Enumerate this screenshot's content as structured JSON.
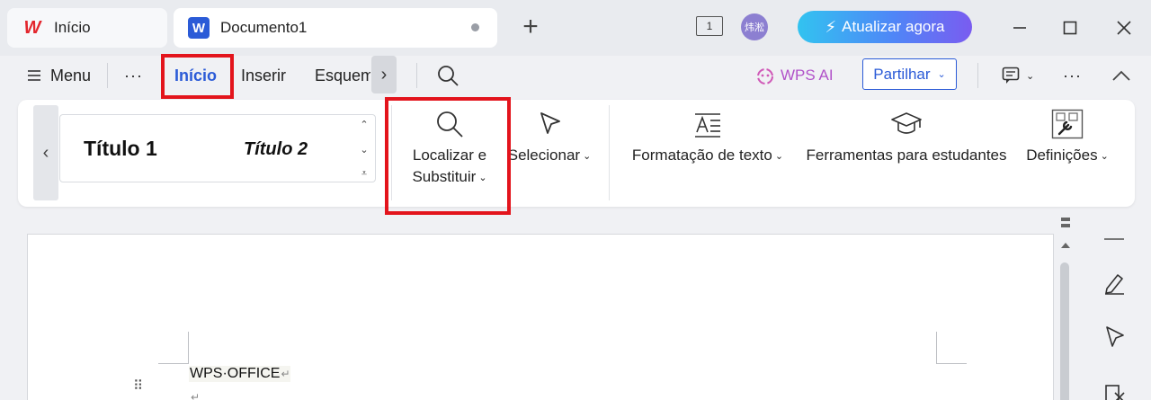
{
  "tabs": {
    "home": {
      "label": "Início",
      "logo": "W"
    },
    "doc": {
      "label": "Documento1",
      "logo": "W"
    },
    "new_tab": "+"
  },
  "titlebar": {
    "doc_count": "1",
    "avatar_text": "炜淞",
    "upgrade_label": "Atualizar agora"
  },
  "menu": {
    "menu_label": "Menu",
    "more": "···",
    "tabs": [
      "Início",
      "Inserir",
      "Esquem"
    ],
    "more_tabs": "›",
    "wps_ai": "WPS AI",
    "share_label": "Partilhar"
  },
  "ribbon": {
    "styles": [
      "Título 1",
      "Título 2"
    ],
    "find_replace": {
      "line1": "Localizar e",
      "line2": "Substituir"
    },
    "select": "Selecionar",
    "text_format": "Formatação de texto",
    "student_tools": "Ferramentas para estudantes",
    "settings": "Definições"
  },
  "document": {
    "text": "WPS·OFFICE",
    "para_mark": "↵"
  },
  "colors": {
    "accent": "#2b5bd7",
    "highlight": "#e3141c",
    "wps_ai": "#b152c9"
  }
}
